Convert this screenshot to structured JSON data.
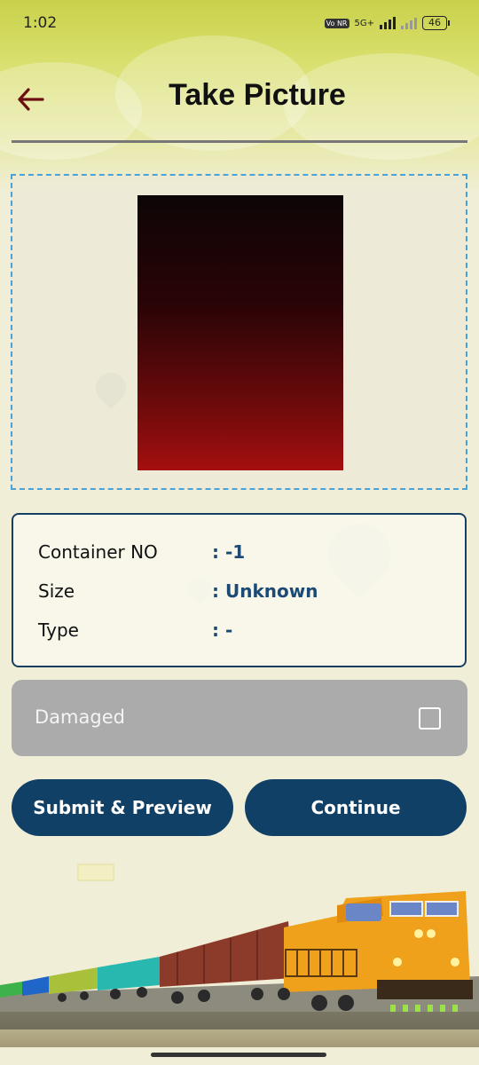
{
  "status_bar": {
    "time": "1:02",
    "network": "5G+",
    "volte": "Vo NR",
    "battery": "46"
  },
  "header": {
    "title": "Take Picture",
    "back_icon": "arrow-left-icon"
  },
  "info": {
    "rows": [
      {
        "label": "Container NO",
        "value": ": -1"
      },
      {
        "label": "Size",
        "value": ": Unknown"
      },
      {
        "label": "Type",
        "value": ": -"
      }
    ]
  },
  "damaged": {
    "label": "Damaged",
    "checked": false
  },
  "buttons": {
    "submit_label": "Submit & Preview",
    "continue_label": "Continue"
  },
  "colors": {
    "primary": "#114066",
    "accent_text": "#1b4a75",
    "dashed_border": "#4aa2d6",
    "header_bg": "#c9d14a"
  }
}
